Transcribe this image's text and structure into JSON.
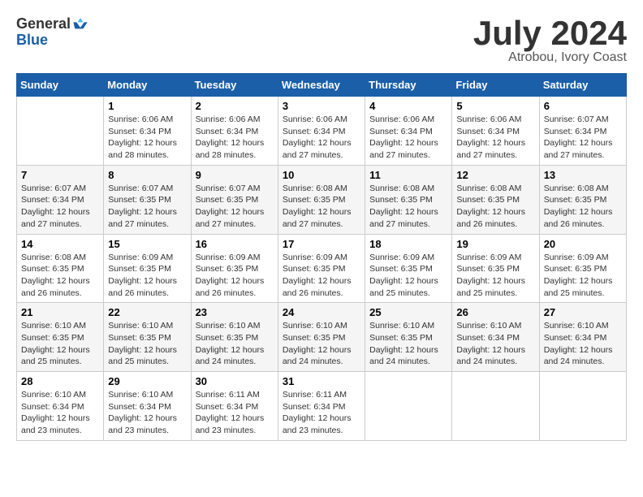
{
  "header": {
    "logo_general": "General",
    "logo_blue": "Blue",
    "title": "July 2024",
    "subtitle": "Atrobou, Ivory Coast"
  },
  "calendar": {
    "days_header": [
      "Sunday",
      "Monday",
      "Tuesday",
      "Wednesday",
      "Thursday",
      "Friday",
      "Saturday"
    ],
    "weeks": [
      [
        {
          "num": "",
          "info": ""
        },
        {
          "num": "1",
          "info": "Sunrise: 6:06 AM\nSunset: 6:34 PM\nDaylight: 12 hours\nand 28 minutes."
        },
        {
          "num": "2",
          "info": "Sunrise: 6:06 AM\nSunset: 6:34 PM\nDaylight: 12 hours\nand 28 minutes."
        },
        {
          "num": "3",
          "info": "Sunrise: 6:06 AM\nSunset: 6:34 PM\nDaylight: 12 hours\nand 27 minutes."
        },
        {
          "num": "4",
          "info": "Sunrise: 6:06 AM\nSunset: 6:34 PM\nDaylight: 12 hours\nand 27 minutes."
        },
        {
          "num": "5",
          "info": "Sunrise: 6:06 AM\nSunset: 6:34 PM\nDaylight: 12 hours\nand 27 minutes."
        },
        {
          "num": "6",
          "info": "Sunrise: 6:07 AM\nSunset: 6:34 PM\nDaylight: 12 hours\nand 27 minutes."
        }
      ],
      [
        {
          "num": "7",
          "info": "Sunrise: 6:07 AM\nSunset: 6:34 PM\nDaylight: 12 hours\nand 27 minutes."
        },
        {
          "num": "8",
          "info": "Sunrise: 6:07 AM\nSunset: 6:35 PM\nDaylight: 12 hours\nand 27 minutes."
        },
        {
          "num": "9",
          "info": "Sunrise: 6:07 AM\nSunset: 6:35 PM\nDaylight: 12 hours\nand 27 minutes."
        },
        {
          "num": "10",
          "info": "Sunrise: 6:08 AM\nSunset: 6:35 PM\nDaylight: 12 hours\nand 27 minutes."
        },
        {
          "num": "11",
          "info": "Sunrise: 6:08 AM\nSunset: 6:35 PM\nDaylight: 12 hours\nand 27 minutes."
        },
        {
          "num": "12",
          "info": "Sunrise: 6:08 AM\nSunset: 6:35 PM\nDaylight: 12 hours\nand 26 minutes."
        },
        {
          "num": "13",
          "info": "Sunrise: 6:08 AM\nSunset: 6:35 PM\nDaylight: 12 hours\nand 26 minutes."
        }
      ],
      [
        {
          "num": "14",
          "info": "Sunrise: 6:08 AM\nSunset: 6:35 PM\nDaylight: 12 hours\nand 26 minutes."
        },
        {
          "num": "15",
          "info": "Sunrise: 6:09 AM\nSunset: 6:35 PM\nDaylight: 12 hours\nand 26 minutes."
        },
        {
          "num": "16",
          "info": "Sunrise: 6:09 AM\nSunset: 6:35 PM\nDaylight: 12 hours\nand 26 minutes."
        },
        {
          "num": "17",
          "info": "Sunrise: 6:09 AM\nSunset: 6:35 PM\nDaylight: 12 hours\nand 26 minutes."
        },
        {
          "num": "18",
          "info": "Sunrise: 6:09 AM\nSunset: 6:35 PM\nDaylight: 12 hours\nand 25 minutes."
        },
        {
          "num": "19",
          "info": "Sunrise: 6:09 AM\nSunset: 6:35 PM\nDaylight: 12 hours\nand 25 minutes."
        },
        {
          "num": "20",
          "info": "Sunrise: 6:09 AM\nSunset: 6:35 PM\nDaylight: 12 hours\nand 25 minutes."
        }
      ],
      [
        {
          "num": "21",
          "info": "Sunrise: 6:10 AM\nSunset: 6:35 PM\nDaylight: 12 hours\nand 25 minutes."
        },
        {
          "num": "22",
          "info": "Sunrise: 6:10 AM\nSunset: 6:35 PM\nDaylight: 12 hours\nand 25 minutes."
        },
        {
          "num": "23",
          "info": "Sunrise: 6:10 AM\nSunset: 6:35 PM\nDaylight: 12 hours\nand 24 minutes."
        },
        {
          "num": "24",
          "info": "Sunrise: 6:10 AM\nSunset: 6:35 PM\nDaylight: 12 hours\nand 24 minutes."
        },
        {
          "num": "25",
          "info": "Sunrise: 6:10 AM\nSunset: 6:35 PM\nDaylight: 12 hours\nand 24 minutes."
        },
        {
          "num": "26",
          "info": "Sunrise: 6:10 AM\nSunset: 6:34 PM\nDaylight: 12 hours\nand 24 minutes."
        },
        {
          "num": "27",
          "info": "Sunrise: 6:10 AM\nSunset: 6:34 PM\nDaylight: 12 hours\nand 24 minutes."
        }
      ],
      [
        {
          "num": "28",
          "info": "Sunrise: 6:10 AM\nSunset: 6:34 PM\nDaylight: 12 hours\nand 23 minutes."
        },
        {
          "num": "29",
          "info": "Sunrise: 6:10 AM\nSunset: 6:34 PM\nDaylight: 12 hours\nand 23 minutes."
        },
        {
          "num": "30",
          "info": "Sunrise: 6:11 AM\nSunset: 6:34 PM\nDaylight: 12 hours\nand 23 minutes."
        },
        {
          "num": "31",
          "info": "Sunrise: 6:11 AM\nSunset: 6:34 PM\nDaylight: 12 hours\nand 23 minutes."
        },
        {
          "num": "",
          "info": ""
        },
        {
          "num": "",
          "info": ""
        },
        {
          "num": "",
          "info": ""
        }
      ]
    ]
  }
}
